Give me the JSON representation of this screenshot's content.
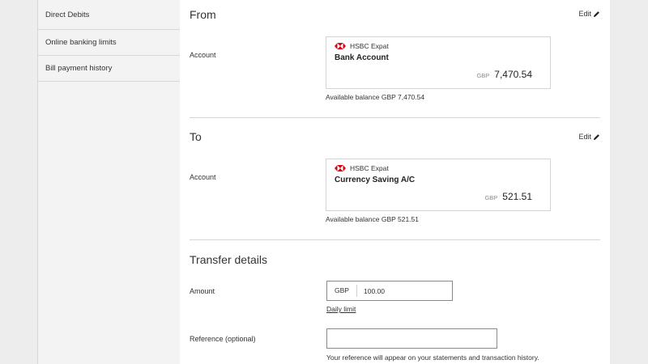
{
  "sidebar": {
    "items": [
      {
        "label": "Direct Debits"
      },
      {
        "label": "Online banking limits"
      },
      {
        "label": "Bill payment history"
      }
    ]
  },
  "from": {
    "title": "From",
    "edit_label": "Edit",
    "account_label": "Account",
    "bank_name": "HSBC Expat",
    "account_name": "Bank Account",
    "currency": "GBP",
    "balance": "7,470.54",
    "available": "Available balance GBP 7,470.54"
  },
  "to": {
    "title": "To",
    "edit_label": "Edit",
    "account_label": "Account",
    "bank_name": "HSBC Expat",
    "account_name": "Currency Saving A/C",
    "currency": "GBP",
    "balance": "521.51",
    "available": "Available balance GBP 521.51"
  },
  "transfer": {
    "title": "Transfer details",
    "amount_label": "Amount",
    "amount_currency": "GBP",
    "amount_value": "100.00",
    "daily_limit_link": "Daily limit",
    "reference_label": "Reference (optional)",
    "reference_value": "",
    "reference_note": "Your reference will appear on your statements and transaction history."
  },
  "colors": {
    "brand_red": "#db0011",
    "page_bg": "#ededed",
    "sidebar_bg": "#f3f3f3"
  }
}
